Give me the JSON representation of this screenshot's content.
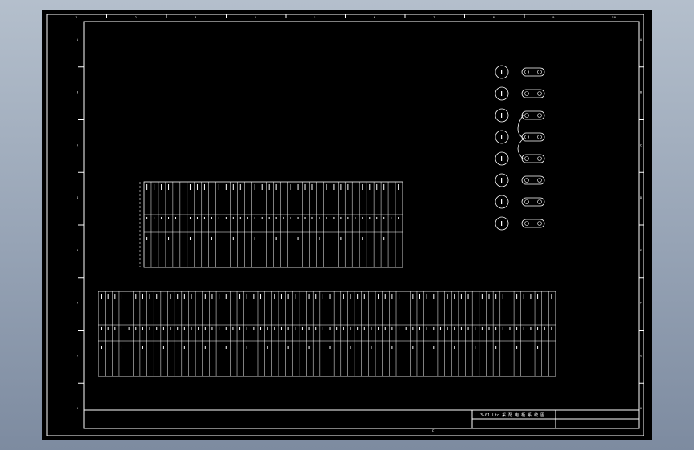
{
  "drawing": {
    "title_block": {
      "title": "3-01 Ltd 采 配 电 柜 系 统 图"
    },
    "border_zone_labels_top": [
      "1",
      "2",
      "3",
      "4",
      "5",
      "6",
      "7",
      "8",
      "9",
      "10"
    ],
    "border_zone_labels_side": [
      "A",
      "B",
      "C",
      "D",
      "E",
      "F",
      "G",
      "H"
    ],
    "bottom_center_label": "F",
    "colors": {
      "background": "#000000",
      "line": "#ffffff",
      "viewport": "#9aa7b8"
    }
  },
  "diagrams": {
    "upper_terminal_strip": {
      "rows": 3,
      "columns": 36
    },
    "lower_terminal_strip": {
      "rows": 3,
      "columns": 66
    },
    "connector_legend": {
      "entries": 8
    }
  }
}
